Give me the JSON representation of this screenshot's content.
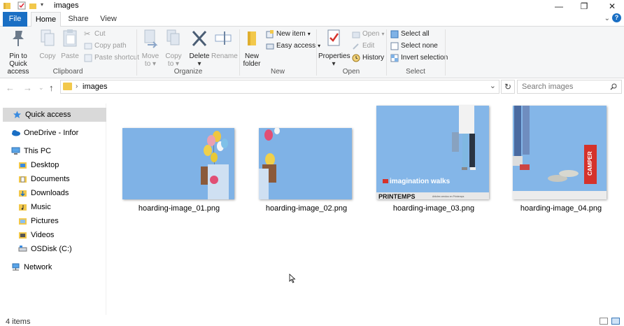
{
  "window": {
    "title": "images",
    "minimize": "—",
    "restore": "❐",
    "close": "✕"
  },
  "ribbon_tabs": [
    "File",
    "Home",
    "Share",
    "View"
  ],
  "ribbon": {
    "clipboard": {
      "label": "Clipboard",
      "pin": "Pin to Quick access",
      "pin_l1": "Pin to Quick",
      "pin_l2": "access",
      "copy": "Copy",
      "paste": "Paste",
      "cut": "Cut",
      "copy_path": "Copy path",
      "paste_shortcut": "Paste shortcut"
    },
    "organize": {
      "label": "Organize",
      "move_l1": "Move",
      "move_l2": "to",
      "copy_l1": "Copy",
      "copy_l2": "to",
      "delete": "Delete",
      "rename": "Rename"
    },
    "new": {
      "label": "New",
      "new_folder_l1": "New",
      "new_folder_l2": "folder",
      "new_item": "New item",
      "easy_access": "Easy access"
    },
    "open": {
      "label": "Open",
      "properties": "Properties",
      "open": "Open",
      "edit": "Edit",
      "history": "History"
    },
    "select": {
      "label": "Select",
      "select_all": "Select all",
      "select_none": "Select none",
      "invert_selection": "Invert selection"
    }
  },
  "address": {
    "crumb": "images",
    "search_placeholder": "Search images"
  },
  "nav_pane": [
    {
      "label": "Quick access",
      "icon": "star-icon",
      "selected": true
    },
    {
      "label": "OneDrive - Infor",
      "icon": "onedrive-icon"
    },
    {
      "label": "This PC",
      "icon": "computer-icon"
    },
    {
      "label": "Desktop",
      "icon": "desktop-folder-icon"
    },
    {
      "label": "Documents",
      "icon": "documents-folder-icon"
    },
    {
      "label": "Downloads",
      "icon": "downloads-folder-icon"
    },
    {
      "label": "Music",
      "icon": "music-folder-icon"
    },
    {
      "label": "Pictures",
      "icon": "pictures-folder-icon"
    },
    {
      "label": "Videos",
      "icon": "videos-folder-icon"
    },
    {
      "label": "OSDisk (C:)",
      "icon": "drive-icon"
    },
    {
      "label": "Network",
      "icon": "network-icon"
    }
  ],
  "files": [
    {
      "name": "hoarding-image_01.png"
    },
    {
      "name": "hoarding-image_02.png"
    },
    {
      "name": "hoarding-image_03.png",
      "poster_text": "imagination walks",
      "poster_brand": "PRINTEMPS",
      "poster_small": "Articles vendus en Printemps"
    },
    {
      "name": "hoarding-image_04.png",
      "poster_brand": "CAMPER"
    }
  ],
  "status": {
    "item_count": "4 items"
  },
  "colors": {
    "accent": "#1a6fc4",
    "sky": "#7fb2e6",
    "folder": "#f2c84b"
  }
}
